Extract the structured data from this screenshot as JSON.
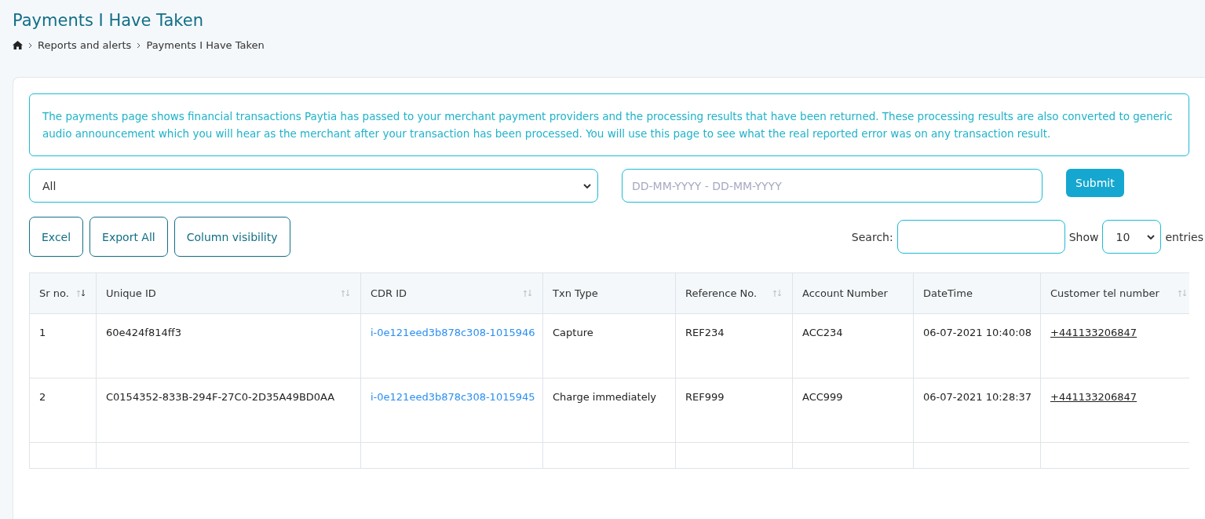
{
  "page_title": "Payments I Have Taken",
  "breadcrumb": [
    "Reports and alerts",
    "Payments I Have Taken"
  ],
  "info": "The payments page shows financial transactions Paytia has passed to your merchant payment providers and the processing results that have been returned. These processing results are also converted to generic audio announcement which you will hear as the merchant after your transaction has been processed. You will use this page to see what the real reported error was on any transaction result.",
  "filter": {
    "value": "All"
  },
  "date_range": {
    "placeholder": "DD-MM-YYYY - DD-MM-YYYY"
  },
  "submit": "Submit",
  "export_buttons": [
    "Excel",
    "Export All",
    "Column visibility"
  ],
  "search": {
    "label": "Search:"
  },
  "length": {
    "before": "Show",
    "value": "10",
    "after": "entries"
  },
  "table": {
    "columns": [
      {
        "label": "Sr no.",
        "sortable": true,
        "sorted": true
      },
      {
        "label": "Unique ID",
        "sortable": true,
        "sorted": false
      },
      {
        "label": "CDR ID",
        "sortable": true,
        "sorted": false
      },
      {
        "label": "Txn Type",
        "sortable": false
      },
      {
        "label": "Reference No.",
        "sortable": true,
        "sorted": false
      },
      {
        "label": "Account Number",
        "sortable": false
      },
      {
        "label": "DateTime",
        "sortable": false
      },
      {
        "label": "Customer tel number",
        "sortable": true,
        "sorted": false
      }
    ],
    "rows": [
      [
        {
          "kind": "text",
          "text": "1"
        },
        {
          "kind": "text",
          "text": "60e424f814ff3"
        },
        {
          "kind": "link",
          "text": "i-0e121eed3b878c308-1015946"
        },
        {
          "kind": "text",
          "text": "Capture"
        },
        {
          "kind": "text",
          "text": "REF234"
        },
        {
          "kind": "text",
          "text": "ACC234"
        },
        {
          "kind": "text",
          "text": "06-07-2021 10:40:08"
        },
        {
          "kind": "tel",
          "text": "+441133206847"
        }
      ],
      [
        {
          "kind": "text",
          "text": "2"
        },
        {
          "kind": "text",
          "text": "C0154352-833B-294F-27C0-2D35A49BD0AA"
        },
        {
          "kind": "link",
          "text": "i-0e121eed3b878c308-1015945"
        },
        {
          "kind": "text",
          "text": "Charge immediately"
        },
        {
          "kind": "text",
          "text": "REF999"
        },
        {
          "kind": "text",
          "text": "ACC999"
        },
        {
          "kind": "text",
          "text": "06-07-2021 10:28:37"
        },
        {
          "kind": "tel",
          "text": "+441133206847"
        }
      ]
    ]
  }
}
